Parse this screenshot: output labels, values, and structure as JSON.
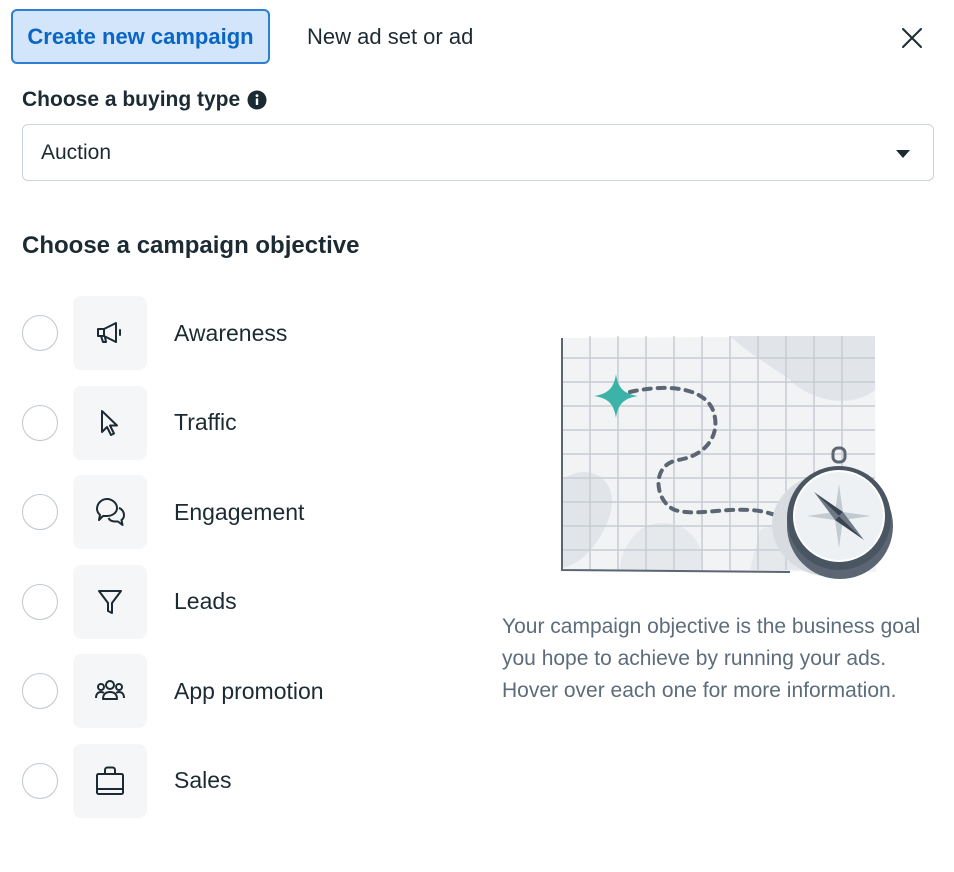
{
  "header": {
    "tabs": [
      {
        "label": "Create new campaign",
        "active": true
      },
      {
        "label": "New ad set or ad",
        "active": false
      }
    ],
    "close_icon": "close-icon"
  },
  "buying_type": {
    "label": "Choose a buying type",
    "info_icon": "info-icon",
    "selected": "Auction",
    "caret_icon": "caret-down-icon"
  },
  "objective": {
    "title": "Choose a campaign objective",
    "options": [
      {
        "label": "Awareness",
        "icon": "megaphone-icon",
        "selected": false
      },
      {
        "label": "Traffic",
        "icon": "cursor-icon",
        "selected": false
      },
      {
        "label": "Engagement",
        "icon": "chat-bubbles-icon",
        "selected": false
      },
      {
        "label": "Leads",
        "icon": "funnel-icon",
        "selected": false
      },
      {
        "label": "App promotion",
        "icon": "people-icon",
        "selected": false
      },
      {
        "label": "Sales",
        "icon": "shopping-bag-icon",
        "selected": false
      }
    ],
    "description": "Your campaign objective is the business goal you hope to achieve by running your ads. Hover over each one for more information."
  },
  "colors": {
    "accent": "#0a66c2",
    "active_tab_bg": "#d3e5fa",
    "illustration_teal": "#3bb3a8"
  }
}
